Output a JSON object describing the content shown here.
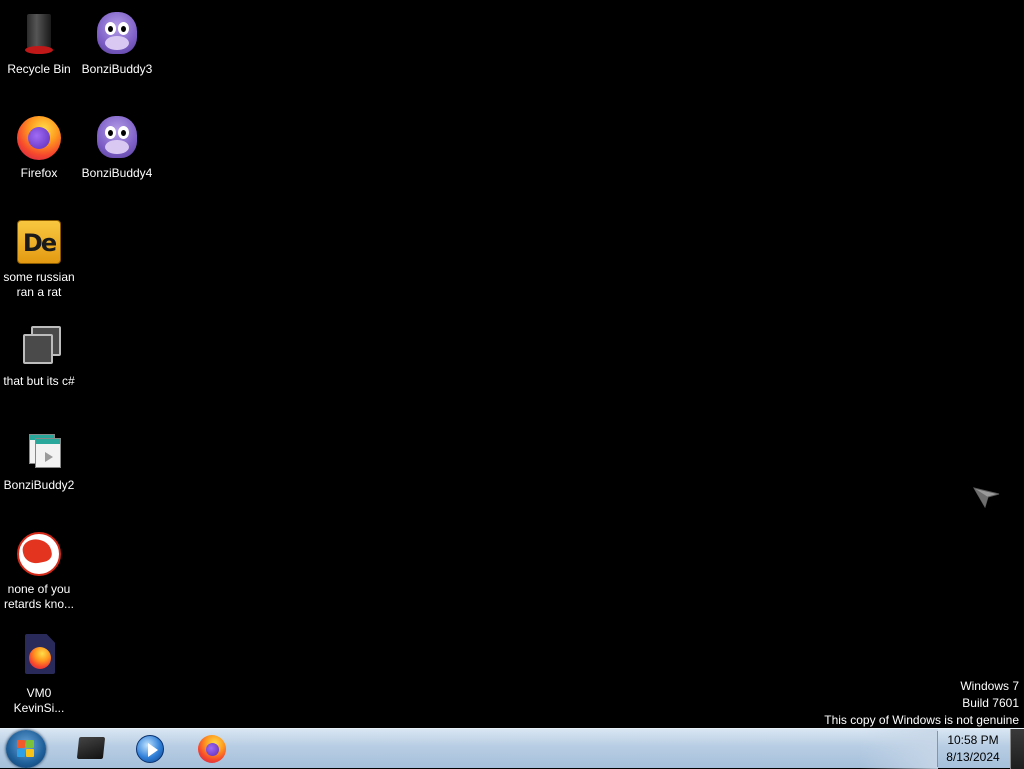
{
  "desktop": {
    "icons": [
      {
        "label": "Recycle Bin"
      },
      {
        "label": "BonziBuddy3"
      },
      {
        "label": "Firefox"
      },
      {
        "label": "BonziBuddy4"
      },
      {
        "label": "some russian ran a rat"
      },
      {
        "label": "that but its c#"
      },
      {
        "label": "BonziBuddy2"
      },
      {
        "label": "none of you retards kno..."
      },
      {
        "label": "VM0 KevinSi..."
      }
    ],
    "de_glyph": "De"
  },
  "watermark": {
    "line1": "Windows 7",
    "line2": "Build 7601",
    "line3": "This copy of Windows is not genuine"
  },
  "taskbar": {
    "pinned": [
      {
        "icon": "explorer-icon"
      },
      {
        "icon": "media-player-icon"
      },
      {
        "icon": "firefox-icon"
      }
    ],
    "clock": {
      "time": "10:58 PM",
      "date": "8/13/2024"
    }
  },
  "colors": {
    "desktop_bg": "#000000",
    "taskbar_top": "#d9e6f3",
    "taskbar_bottom": "#a6c0db",
    "start_orb": "#1f5f99"
  }
}
